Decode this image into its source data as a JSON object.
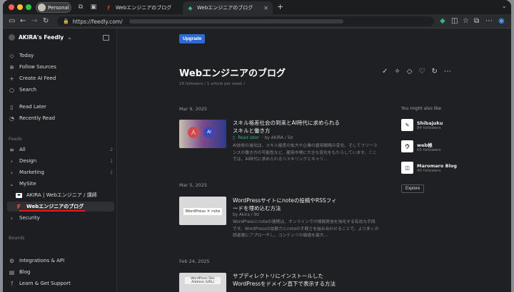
{
  "browser": {
    "traffic_colors": [
      "#ff5f57",
      "#febc2e",
      "#28c840"
    ],
    "profile_label": "Personal",
    "tabs": [
      {
        "label": "Webエンジニアのブログ",
        "favicon": "F"
      },
      {
        "label": "Webエンジニアのブログ",
        "favicon": "◆"
      }
    ],
    "address_url": "https://feedly.com/"
  },
  "sidebar": {
    "account": "AKIRA's Feedly",
    "top_items": [
      {
        "label": "Today",
        "icon": "today-icon"
      },
      {
        "label": "Follow Sources",
        "icon": "follow-icon"
      },
      {
        "label": "Create AI Feed",
        "icon": "plus-icon"
      },
      {
        "label": "Search",
        "icon": "search-icon"
      }
    ],
    "read_items": [
      {
        "label": "Read Later",
        "icon": "bookmark-icon"
      },
      {
        "label": "Recently Read",
        "icon": "clock-icon"
      }
    ],
    "feeds_label": "Feeds",
    "feeds": [
      {
        "label": "All",
        "count": "2"
      },
      {
        "label": "Design",
        "count": "1"
      },
      {
        "label": "Marketing",
        "count": "1"
      },
      {
        "label": "MySite",
        "count": ""
      }
    ],
    "mysite_children": [
      {
        "label": "AKIRA | Webエンジニア / 講師"
      },
      {
        "label": "Webエンジニアのブログ"
      }
    ],
    "security": "Security",
    "boards_label": "Boards",
    "bottom_items": [
      {
        "label": "Integrations & API"
      },
      {
        "label": "Blog"
      },
      {
        "label": "Learn & Get Support"
      }
    ]
  },
  "main": {
    "upgrade": "Upgrade",
    "title": "Webエンジニアのブログ",
    "subtitle": "18 followers / 1 article per week /",
    "articles": [
      {
        "date": "Mar 9, 2025",
        "title": "スキル格差社会の到来とAI時代に求められるスキルと働き方",
        "read_later": "Read later",
        "meta": "· by AKIRA / 5d",
        "summary": "AI技術の進化は、スキル格差の拡大や企業の雇用戦略の変化、そしてフリーランスの働き方の可能性など、雇用市場に大きな変化をもたらしています。ここでは、AI時代に求められるリスキリングとキャリ..."
      },
      {
        "date": "Mar 5, 2025",
        "title": "WordPressサイトにnoteの投稿やRSSフィードを埋め込む方法",
        "meta": "by Akira / 9d",
        "thumb_text": "WordPress ✕ note",
        "summary": "WordPressとnoteの連携は、オンラインでの情報発信を強化する有効な手段です。WordPressの拡散力とnoteの手軽さを組み合わせることで、より多くの読者層にアプローチし、コンテンツの価値を最大..."
      },
      {
        "date": "Feb 24, 2025",
        "title": "サブディレクトリにインストールしたWordPressをドメイン直下で表示する方法",
        "thumb_text": "WordPress Site Address (URL)"
      }
    ],
    "also_like": "You might also like",
    "recommendations": [
      {
        "name": "Shibajuku",
        "followers": "84 followers",
        "logo": "✎"
      },
      {
        "name": "web帳",
        "followers": "65 followers",
        "logo": "ウ"
      },
      {
        "name": "Maromaro Blog",
        "followers": "40 followers",
        "logo": "◫"
      }
    ],
    "explore": "Explore"
  }
}
